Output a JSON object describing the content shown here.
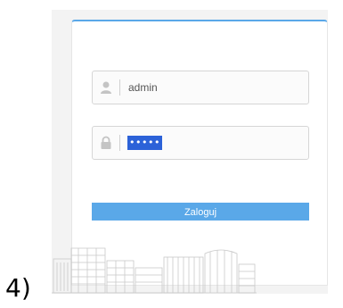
{
  "step": {
    "label": "4)"
  },
  "login": {
    "username_value": "admin",
    "password_mask": "•••••",
    "submit_label": "Zaloguj"
  },
  "colors": {
    "accent": "#5aa8e8",
    "selection": "#2c62d8"
  },
  "icons": {
    "username": "user-icon",
    "password": "lock-icon"
  }
}
